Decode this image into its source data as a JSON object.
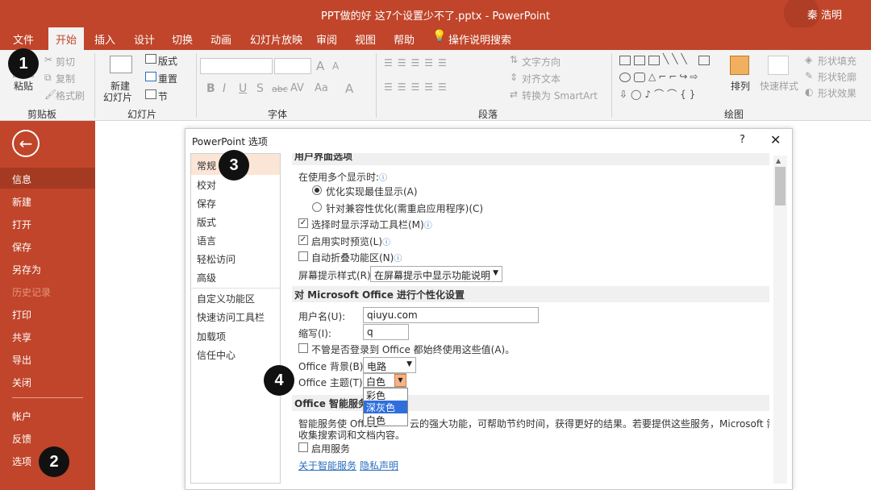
{
  "window": {
    "title": "PPT做的好 这7个设置少不了.pptx  -  PowerPoint",
    "user": "秦 浩明"
  },
  "tabs": [
    "文件",
    "开始",
    "插入",
    "设计",
    "切换",
    "动画",
    "幻灯片放映",
    "审阅",
    "视图",
    "帮助",
    "操作说明搜索"
  ],
  "ribbon": {
    "clipboard": {
      "paste": "粘贴",
      "cut": "剪切",
      "copy": "复制",
      "format_painter": "格式刷",
      "label": "剪贴板"
    },
    "slides": {
      "new_slide_1": "新建",
      "new_slide_2": "幻灯片",
      "layout": "版式",
      "reset": "重置",
      "section": "节",
      "label": "幻灯片"
    },
    "font": {
      "bold": "B",
      "italic": "I",
      "underline": "U",
      "strike": "S",
      "abc": "abc",
      "av": "AV",
      "aa": "Aa",
      "a": "A",
      "grow": "A",
      "shrink": "A",
      "label": "字体"
    },
    "paragraph": {
      "text_direction": "文字方向",
      "align_text": "对齐文本",
      "smartart": "转换为 SmartArt",
      "label": "段落"
    },
    "drawing": {
      "arrange": "排列",
      "quick_styles": "快速样式",
      "fill": "形状填充",
      "outline": "形状轮廓",
      "effects": "形状效果",
      "label": "绘图"
    }
  },
  "sidebar": {
    "items": [
      "信息",
      "新建",
      "打开",
      "保存",
      "另存为",
      "历史记录",
      "打印",
      "共享",
      "导出",
      "关闭",
      "帐户",
      "反馈",
      "选项"
    ]
  },
  "dialog": {
    "title": "PowerPoint 选项",
    "help": "?",
    "close": "✕",
    "nav": [
      "常规",
      "校对",
      "保存",
      "版式",
      "语言",
      "轻松访问",
      "高级",
      "自定义功能区",
      "快速访问工具栏",
      "加载项",
      "信任中心"
    ],
    "ui_section": "用户界面选项",
    "multi_display": "在使用多个显示时:",
    "opt_best": "优化实现最佳显示(A)",
    "opt_compat": "针对兼容性优化(需重启应用程序)(C)",
    "mini_toolbar": "选择时显示浮动工具栏(M)",
    "live_preview": "启用实时预览(L)",
    "collapse_ribbon": "自动折叠功能区(N)",
    "screentip_label": "屏幕提示样式(R):",
    "screentip_value": "在屏幕提示中显示功能说明",
    "personalize_section": "对 Microsoft Office 进行个性化设置",
    "username_label": "用户名(U):",
    "username_value": "qiuyu.com",
    "initials_label": "缩写(I):",
    "initials_value": "q",
    "always_use": "不管是否登录到 Office 都始终使用这些值(A)。",
    "background_label": "Office 背景(B):",
    "background_value": "电路",
    "theme_label": "Office 主题(T):",
    "theme_value": "白色",
    "theme_options": [
      "彩色",
      "深灰色",
      "白色"
    ],
    "intelligent_section": "Office 智能服务",
    "intelligent_text_1a": "智能服务使 Office",
    "intelligent_text_1b": "云的强大功能，可帮助节约时间，获得更好的结果。若要提供这些服务，Microsoft 需要能够",
    "intelligent_text_2": "收集搜索词和文档内容。",
    "enable_services": "启用服务",
    "about_link": "关于智能服务",
    "privacy_link": "隐私声明"
  },
  "badges": [
    "1",
    "2",
    "3",
    "4"
  ]
}
